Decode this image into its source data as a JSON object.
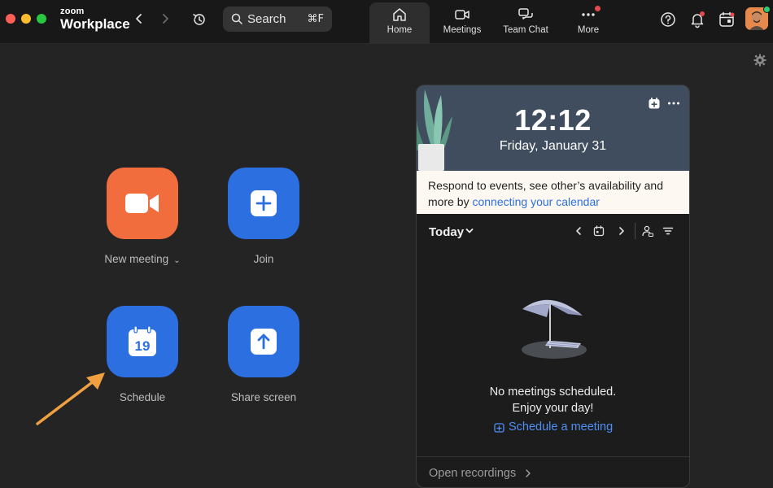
{
  "app": {
    "brand_top": "zoom",
    "brand_main": "Workplace"
  },
  "search": {
    "label": "Search",
    "shortcut": "⌘F"
  },
  "tabs": [
    {
      "label": "Home",
      "icon": "home-icon",
      "active": true
    },
    {
      "label": "Meetings",
      "icon": "video-camera-icon",
      "active": false
    },
    {
      "label": "Team Chat",
      "icon": "chat-bubbles-icon",
      "active": false
    },
    {
      "label": "More",
      "icon": "more-dots-icon",
      "active": false,
      "badge": true
    }
  ],
  "actions": {
    "new_meeting": "New meeting",
    "join": "Join",
    "schedule": "Schedule",
    "share_screen": "Share screen",
    "schedule_day": "19"
  },
  "calendar_panel": {
    "time": "12:12",
    "date": "Friday, January 31",
    "notice_text": "Respond to events, see other’s availability and more by ",
    "notice_link": "connecting your calendar",
    "today_label": "Today",
    "empty_line1": "No meetings scheduled.",
    "empty_line2": "Enjoy your day!",
    "schedule_link": "Schedule a meeting",
    "open_recordings": "Open recordings"
  },
  "colors": {
    "accent_blue": "#2b6fe0",
    "accent_orange": "#f26d3d",
    "annotation_arrow": "#f0a040"
  }
}
